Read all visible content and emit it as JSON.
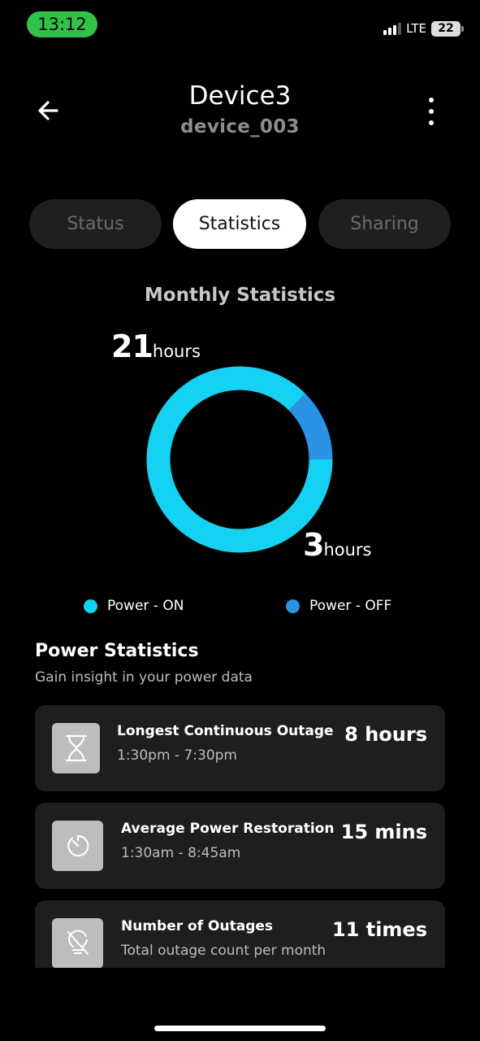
{
  "status_bar": {
    "time": "13:12",
    "network": "LTE",
    "battery": "22"
  },
  "header": {
    "title": "Device3",
    "subtitle": "device_003"
  },
  "tabs": [
    {
      "label": "Status",
      "active": false
    },
    {
      "label": "Statistics",
      "active": true
    },
    {
      "label": "Sharing",
      "active": false
    }
  ],
  "chart_data": {
    "type": "pie",
    "title": "Monthly Statistics",
    "slices": [
      {
        "label": "Power - ON",
        "value": 21,
        "unit": "hours",
        "color": "#15d2f2"
      },
      {
        "label": "Power - OFF",
        "value": 3,
        "unit": "hours",
        "color": "#2a93e6"
      }
    ],
    "legend_position": "bottom"
  },
  "chart_labels": {
    "on_value": "21",
    "on_unit": "hours",
    "off_value": "3",
    "off_unit": "hours"
  },
  "legend": [
    {
      "label": "Power - ON",
      "color": "#15d2f2"
    },
    {
      "label": "Power - OFF",
      "color": "#2a93e6"
    }
  ],
  "power_statistics": {
    "title": "Power Statistics",
    "subtitle": "Gain insight in your power data",
    "cards": [
      {
        "icon": "hourglass-icon",
        "label": "Longest Continuous Outage",
        "sub": "1:30pm - 7:30pm",
        "value": "8 hours"
      },
      {
        "icon": "timer-icon",
        "label": "Average Power Restoration",
        "sub": "1:30am - 8:45am",
        "value": "15 mins"
      },
      {
        "icon": "bulb-off-icon",
        "label": "Number of Outages",
        "sub": "Total outage count per month",
        "value": "11 times"
      }
    ]
  }
}
